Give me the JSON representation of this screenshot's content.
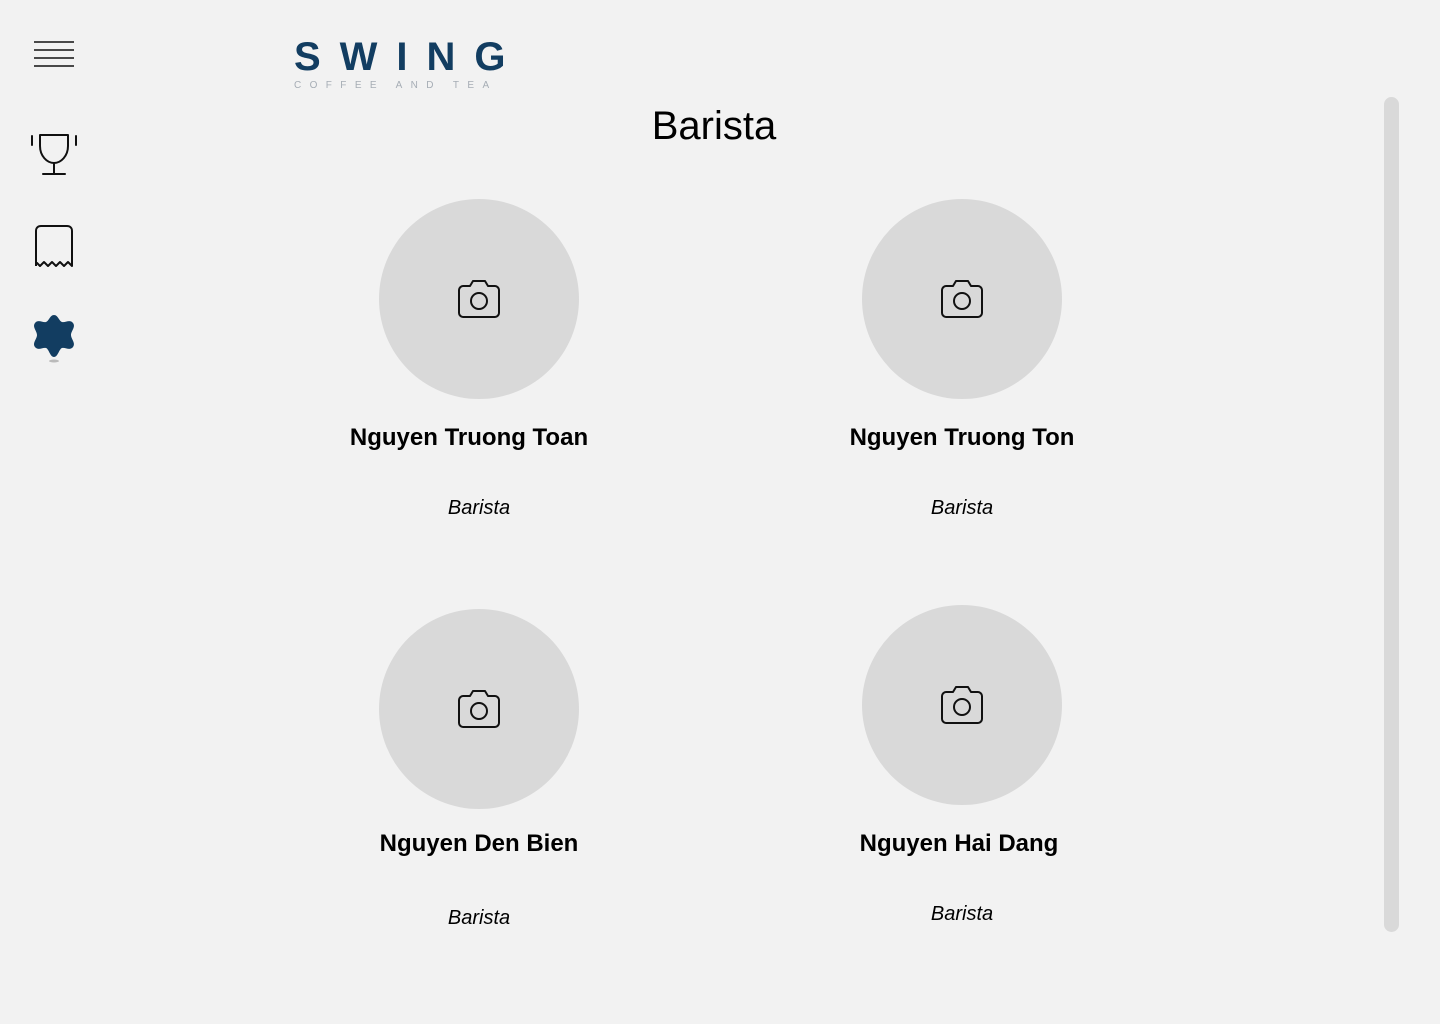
{
  "sidebar": {
    "menu_icon": "hamburger-menu-icon",
    "items": [
      {
        "icon": "trophy-icon"
      },
      {
        "icon": "receipt-icon"
      },
      {
        "icon": "settings-gear-icon",
        "active": true
      }
    ],
    "active_color": "#123d61"
  },
  "brand": {
    "name": "SWING",
    "tagline": "COFFEE AND TEA",
    "color": "#123d61"
  },
  "page": {
    "title": "Barista"
  },
  "staff": [
    {
      "name": "Nguyen Truong Toan",
      "role": "Barista",
      "photo_icon": "camera-icon"
    },
    {
      "name": "Nguyen Truong Ton",
      "role": "Barista",
      "photo_icon": "camera-icon"
    },
    {
      "name": "Nguyen Den Bien",
      "role": "Barista",
      "photo_icon": "camera-icon"
    },
    {
      "name": "Nguyen Hai Dang",
      "role": "Barista",
      "photo_icon": "camera-icon"
    }
  ]
}
